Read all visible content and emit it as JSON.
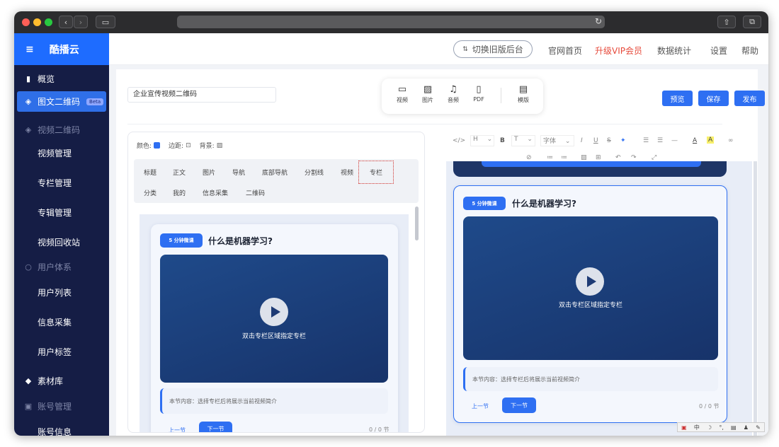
{
  "sidebar": {
    "brand": "酷播云",
    "items": [
      {
        "label": "概览"
      },
      {
        "label": "图文二维码",
        "badge": "Beta"
      },
      {
        "label": "视频二维码"
      },
      {
        "label": "视频管理"
      },
      {
        "label": "专栏管理"
      },
      {
        "label": "专辑管理"
      },
      {
        "label": "视频回收站"
      },
      {
        "label": "用户体系"
      },
      {
        "label": "用户列表"
      },
      {
        "label": "信息采集"
      },
      {
        "label": "用户标签"
      },
      {
        "label": "素材库"
      },
      {
        "label": "账号管理"
      },
      {
        "label": "账号信息"
      }
    ]
  },
  "header": {
    "switch_label": "切换旧版后台",
    "links": [
      "官网首页",
      "升级VIP会员",
      "数据统计",
      "设置",
      "帮助"
    ]
  },
  "editor": {
    "title_value": "企业宣传视频二维码",
    "tools": [
      "视频",
      "图片",
      "音频",
      "PDF",
      "模版"
    ],
    "preview": "预览",
    "save": "保存",
    "publish": "发布"
  },
  "panel": {
    "color_label": "颜色:",
    "margin_label": "边距:",
    "bg_label": "背景:",
    "components": [
      "标题",
      "正文",
      "图片",
      "导航",
      "底部导航",
      "分割线",
      "视频",
      "专栏",
      "分类",
      "我的",
      "信息采集",
      "二维码"
    ]
  },
  "card": {
    "tag": "5 分钟微课",
    "title": "什么是机器学习?",
    "video_hint": "双击专栏区域指定专栏",
    "desc": "本节内容：选择专栏后将展示当前视频简介",
    "prev": "上一节",
    "next": "下一节",
    "count": "0 / 0 节"
  },
  "format_toolbar": {
    "heading": "H",
    "text": "T",
    "font": "字体"
  },
  "ime": {
    "lang": "中"
  },
  "colors": {
    "accent": "#2e6ff2",
    "sidebar": "#151d45",
    "vip": "#e64a3b"
  }
}
